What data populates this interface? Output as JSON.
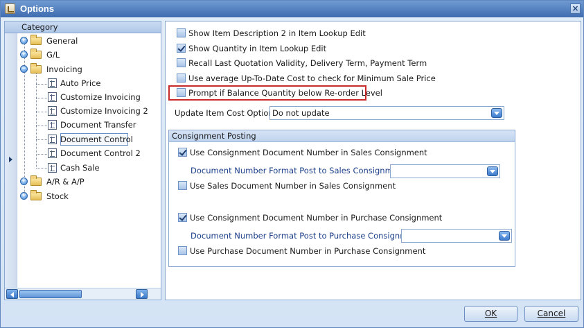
{
  "window": {
    "title": "Options",
    "close_label": "×"
  },
  "category": {
    "header": "Category",
    "items": [
      {
        "label": "General"
      },
      {
        "label": "G/L"
      },
      {
        "label": "Invoicing"
      },
      {
        "label": "Auto Price"
      },
      {
        "label": "Customize Invoicing"
      },
      {
        "label": "Customize Invoicing 2"
      },
      {
        "label": "Document Transfer"
      },
      {
        "label": "Document Control"
      },
      {
        "label": "Document Control 2"
      },
      {
        "label": "Cash Sale"
      },
      {
        "label": "A/R & A/P"
      },
      {
        "label": "Stock"
      }
    ],
    "selected": "Document Control"
  },
  "settings": {
    "options": [
      {
        "label": "Show Item Description 2 in Item Lookup Edit",
        "checked": false
      },
      {
        "label": "Show Quantity in Item Lookup Edit",
        "checked": true
      },
      {
        "label": "Recall Last Quotation Validity, Delivery Term, Payment Term",
        "checked": false
      },
      {
        "label": "Use average Up-To-Date Cost to check for Minimum Sale Price",
        "checked": false
      },
      {
        "label": "Prompt if Balance Quantity below Re-order Level",
        "checked": false
      }
    ],
    "update_cost_label": "Update Item Cost Option:",
    "update_cost_value": "Do not update",
    "consignment": {
      "title": "Consignment Posting",
      "use_consign_sales": {
        "label": "Use Consignment Document Number in Sales Consignment",
        "checked": true
      },
      "sales_format_label": "Document Number Format Post to Sales Consignment:",
      "sales_format_value": "",
      "use_sales_doc": {
        "label": "Use Sales Document Number in Sales Consignment",
        "checked": false
      },
      "use_consign_purchase": {
        "label": "Use Consignment Document Number in Purchase Consignment",
        "checked": true
      },
      "purchase_format_label": "Document Number Format Post to Purchase Consignment:",
      "purchase_format_value": "",
      "use_purchase_doc": {
        "label": "Use Purchase Document Number in Purchase Consignment",
        "checked": false
      }
    }
  },
  "buttons": {
    "ok": "OK",
    "cancel": "Cancel"
  },
  "colors": {
    "highlight": "#c62a2a",
    "title_bar": "#4f7cc0",
    "label_blue": "#1c3f8a"
  }
}
